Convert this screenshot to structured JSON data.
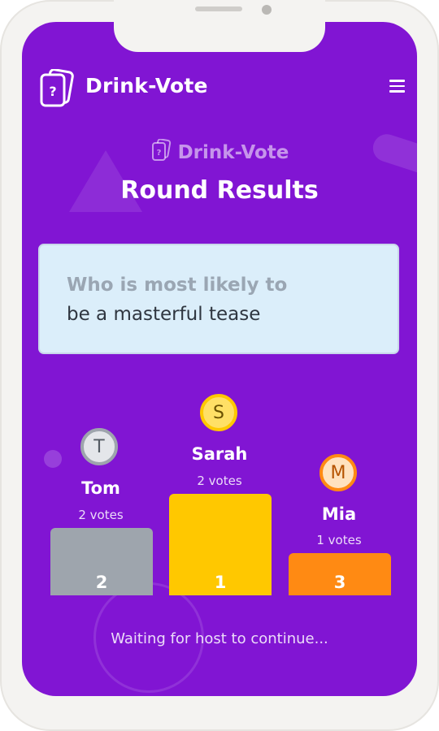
{
  "header": {
    "app_title": "Drink-Vote",
    "logo_icon": "cards-question-icon",
    "menu_icon": "hamburger-menu-icon"
  },
  "main": {
    "brand_label": "Drink-Vote",
    "title": "Round Results",
    "question": {
      "prefix": "Who is most likely to",
      "text": "be a masterful tease"
    },
    "podium": [
      {
        "initial": "T",
        "name": "Tom",
        "votes": "2 votes",
        "rank": "2",
        "color": "#9ea5ad",
        "height_fraction": 0.66
      },
      {
        "initial": "S",
        "name": "Sarah",
        "votes": "2 votes",
        "rank": "1",
        "color": "#ffc800",
        "height_fraction": 1.0
      },
      {
        "initial": "M",
        "name": "Mia",
        "votes": "1 votes",
        "rank": "3",
        "color": "#ff8a13",
        "height_fraction": 0.42
      }
    ],
    "status": "Waiting for host to continue..."
  },
  "colors": {
    "background": "#8115d3",
    "card": "#dbeefa"
  }
}
